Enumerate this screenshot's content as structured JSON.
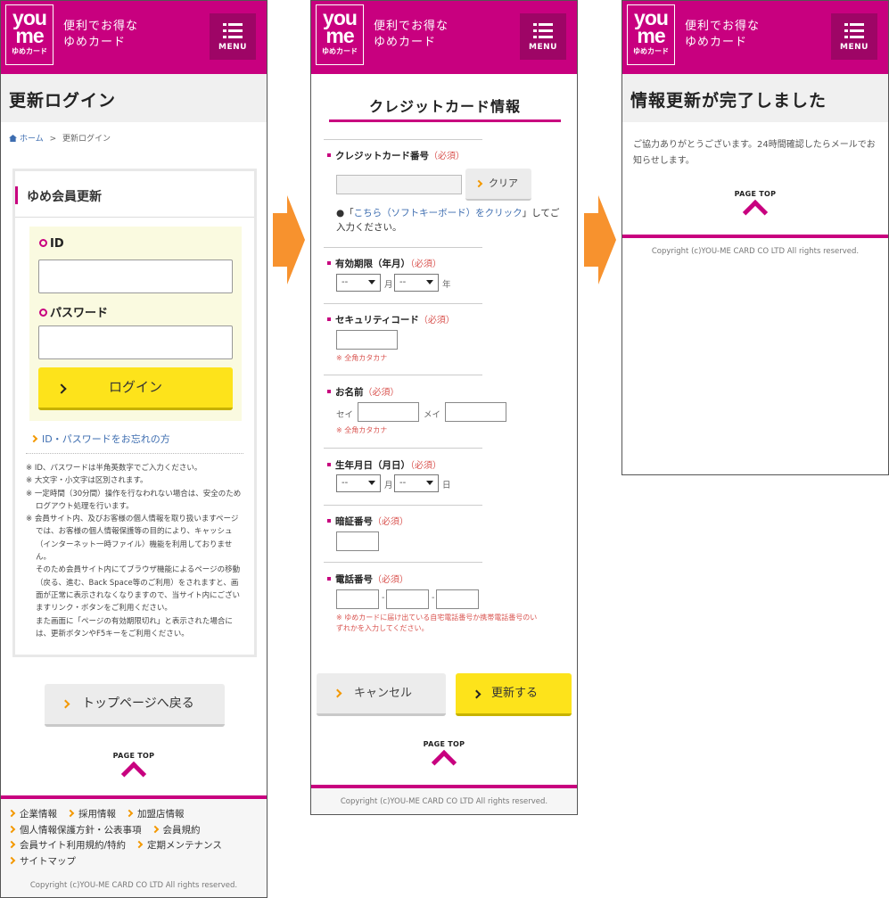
{
  "brand": {
    "logo_top": "you",
    "logo_mid": "me",
    "logo_sub": "ゆめカード",
    "tagline_line1": "便利でお得な",
    "tagline_line2": "ゆめカード",
    "menu_label": "MENU",
    "color_primary": "#c8007f"
  },
  "login_page": {
    "title": "更新ログイン",
    "breadcrumb_home": "ホーム",
    "breadcrumb_sep": ">",
    "breadcrumb_current": "更新ログイン",
    "box_title": "ゆめ会員更新",
    "id_label": "ID",
    "password_label": "パスワード",
    "login_button": "ログイン",
    "forgot_link": "ID・パスワードをお忘れの方",
    "notes": [
      "※ ID、パスワードは半角英数字でご入力ください。",
      "※ 大文字・小文字は区別されます。",
      "※ 一定時間（30分間）操作を行なわれない場合は、安全のためログアウト処理を行います。",
      "※ 会員サイト内、及びお客様の個人情報を取り扱いますページでは、お客様の個人情報保護等の目的により、キャッシュ（インターネット一時ファイル）機能を利用しておりません。",
      "そのため会員サイト内にてブラウザ機能によるページの移動（戻る、進む、Back Space等のご利用）をされますと、画面が正常に表示されなくなりますので、当サイト内にございますリンク・ボタンをご利用ください。",
      "また画面に「ページの有効期限切れ」と表示された場合には、更新ボタンやF5キーをご利用ください。"
    ],
    "back_to_top_button": "トップページへ戻る",
    "footer_links": [
      "企業情報",
      "採用情報",
      "加盟店情報",
      "個人情報保護方針・公表事項",
      "会員規約",
      "会員サイト利用規約/特約",
      "定期メンテナンス",
      "サイトマップ"
    ]
  },
  "credit_page": {
    "title": "クレジットカード情報",
    "required": "（必須）",
    "card_number_label": "クレジットカード番号",
    "clear_button": "クリア",
    "soft_kb_bullet": "●",
    "soft_kb_pre": "「",
    "soft_kb_link": "こちら（ソフトキーボード）をクリック",
    "soft_kb_post": "」してご入力ください。",
    "expiry_label": "有効期限（年月）",
    "select_placeholder": "--",
    "unit_month": "月",
    "unit_year": "年",
    "security_label": "セキュリティコード",
    "katakana_hint": "※ 全角カタカナ",
    "name_label": "お名前",
    "sei": "セイ",
    "mei": "メイ",
    "birth_label": "生年月日（月日）",
    "unit_day": "日",
    "pin_label": "暗証番号",
    "phone_label": "電話番号",
    "phone_dash": "-",
    "phone_hint": "※ ゆめカードに届け出ている自宅電話番号か携帯電話番号のいずれかを入力してください。",
    "cancel_button": "キャンセル",
    "update_button": "更新する"
  },
  "complete_page": {
    "title": "情報更新が完了しました",
    "message": "ご協力ありがとうございます。24時間確認したらメールでお知らせします。"
  },
  "common": {
    "page_top": "PAGE TOP",
    "copyright": "Copyright (c)YOU-ME CARD CO LTD All rights reserved."
  }
}
